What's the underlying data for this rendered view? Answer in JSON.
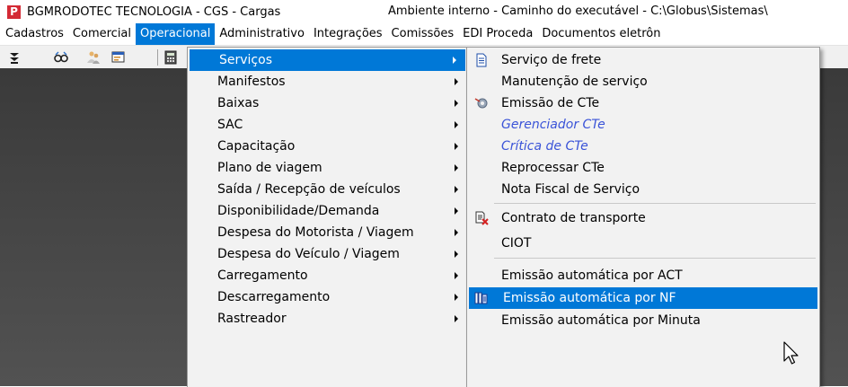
{
  "window": {
    "title": "BGMRODOTEC TECNOLOGIA - CGS - Cargas",
    "title_extra": "Ambiente interno - Caminho do executável - C:\\Globus\\Sistemas\\",
    "icon_letter": "P"
  },
  "menubar": {
    "items": [
      "Cadastros",
      "Comercial",
      "Operacional",
      "Administrativo",
      "Integrações",
      "Comissões",
      "EDI Proceda",
      "Documentos eletrôn"
    ]
  },
  "toolbar": {
    "icons": [
      "download-arrows-icon",
      "glasses-icon",
      "people-icon",
      "window-icon",
      "calculator-icon"
    ]
  },
  "submenu_operacional": [
    {
      "label": "Serviços"
    },
    {
      "label": "Manifestos"
    },
    {
      "label": "Baixas"
    },
    {
      "label": "SAC"
    },
    {
      "label": "Capacitação"
    },
    {
      "label": "Plano de viagem"
    },
    {
      "label": "Saída / Recepção de veículos"
    },
    {
      "label": "Disponibilidade/Demanda"
    },
    {
      "label": "Despesa do Motorista / Viagem"
    },
    {
      "label": "Despesa do Veículo / Viagem"
    },
    {
      "label": "Carregamento"
    },
    {
      "label": "Descarregamento"
    },
    {
      "label": "Rastreador"
    }
  ],
  "submenu_servicos": [
    {
      "label": "Serviço de frete"
    },
    {
      "label": "Manutenção de serviço"
    },
    {
      "label": "Emissão de CTe"
    },
    {
      "label": "Gerenciador CTe"
    },
    {
      "label": "Crítica de CTe"
    },
    {
      "label": "Reprocessar CTe"
    },
    {
      "label": "Nota Fiscal de Serviço"
    },
    {
      "label": "Contrato de transporte"
    },
    {
      "label": "CIOT"
    },
    {
      "label": "Emissão automática por ACT"
    },
    {
      "label": "Emissão automática por NF"
    },
    {
      "label": "Emissão automática por Minuta"
    }
  ],
  "colors": {
    "accent": "#0078d7",
    "link_italic": "#3b54d8",
    "workspace": "#464646"
  }
}
